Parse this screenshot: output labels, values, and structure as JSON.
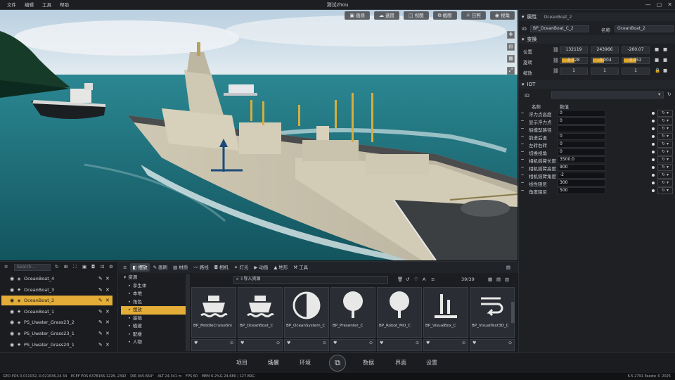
{
  "titlebar": {
    "menus": [
      "文件",
      "编辑",
      "工具",
      "帮助"
    ],
    "title": "测试zhou",
    "min": "—",
    "max": "▢",
    "close": "✕"
  },
  "viewport": {
    "toolbar": [
      {
        "icon": "image-icon",
        "label": "画质"
      },
      {
        "icon": "weather-icon",
        "label": "速度"
      },
      {
        "icon": "view-icon",
        "label": "视图"
      },
      {
        "icon": "screenshot-icon",
        "label": "截图"
      },
      {
        "icon": "sun-icon",
        "label": "日照"
      },
      {
        "icon": "eye-icon",
        "label": "视角"
      }
    ],
    "colors": {
      "sky": "#c9d9e6",
      "sea": "#1d7380",
      "ship_hull": "#d9d4c2",
      "deck": "#4b4d4f"
    }
  },
  "props": {
    "header": "属性",
    "object_title": "OceanBoat_2",
    "id_label": "ID",
    "id_value": "BP_OceanBoat_C_2",
    "name_label": "名称",
    "name_value": "OceanBoat_2",
    "transform_header": "变换",
    "position_label": "位置",
    "position": [
      "132119",
      "243966",
      "-260.07"
    ],
    "rotation_label": "旋转",
    "rotation": [
      "0.328",
      "-0.004",
      "0.352"
    ],
    "scale_label": "缩放",
    "scale": [
      "1",
      "1",
      "1"
    ],
    "iot_header": "IOT",
    "iot_id_label": "ID",
    "col_name": "名称",
    "col_value": "数值",
    "iot_rows": [
      {
        "name": "浮力点高度",
        "value": "0"
      },
      {
        "name": "显示浮力点",
        "value": "0"
      },
      {
        "name": "船模型路径",
        "value": ""
      },
      {
        "name": "前进后退",
        "value": "0"
      },
      {
        "name": "左转右转",
        "value": "0"
      },
      {
        "name": "切换视角",
        "value": "0"
      },
      {
        "name": "相机摇臂长度",
        "value": "3500.0"
      },
      {
        "name": "相机摇臂高度",
        "value": "900"
      },
      {
        "name": "相机摇臂角度",
        "value": "-2"
      },
      {
        "name": "线性阻尼",
        "value": "300"
      },
      {
        "name": "角度阻尼",
        "value": "500"
      }
    ]
  },
  "outliner": {
    "search_placeholder": "Search...",
    "items": [
      {
        "name": "OceanBoat_4",
        "selected": false
      },
      {
        "name": "OceanBoat_3",
        "selected": false
      },
      {
        "name": "OceanBoat_2",
        "selected": true
      },
      {
        "name": "OceanBoat_1",
        "selected": false
      },
      {
        "name": "PS_Uwater_Grass23_2",
        "selected": false
      },
      {
        "name": "PS_Uwater_Grass23_1",
        "selected": false
      },
      {
        "name": "PS_Uwater_Grass20_1",
        "selected": false
      }
    ]
  },
  "content": {
    "tabs": [
      "摆放",
      "画刷",
      "材质",
      "路线",
      "相机",
      "灯光",
      "动画",
      "地形",
      "工具"
    ],
    "tree": [
      "资源",
      "孪生体",
      "本地",
      "角色",
      "摆放",
      "基础",
      "植被",
      "配楼",
      "人物"
    ],
    "import_label": "导入资源",
    "count": "39/39",
    "assets": [
      "BP_MiddleCruiseShi",
      "BP_OceanBoat_C",
      "BP_OceanSystem_C",
      "BP_Presenter_C",
      "BP_Robot_MO_C",
      "BP_VisualBox_C",
      "BP_VisualText3D_C"
    ]
  },
  "bottomnav": {
    "items": [
      "项目",
      "场景",
      "环境",
      "数据",
      "界面",
      "设置"
    ],
    "active": "场景"
  },
  "status": {
    "geo": "GEO POS  0.011032,-0.021636,24.34",
    "ecef": "ECEF POS  6378166.1228,-2392",
    "dir": "DIR  045.664°",
    "alt": "ALT  24.341 m",
    "fps": "FPS  60",
    "mem": "MEM  6.2%G  24.680 / 127.89G",
    "version": "6.5.2791  Paeste © 2025"
  }
}
